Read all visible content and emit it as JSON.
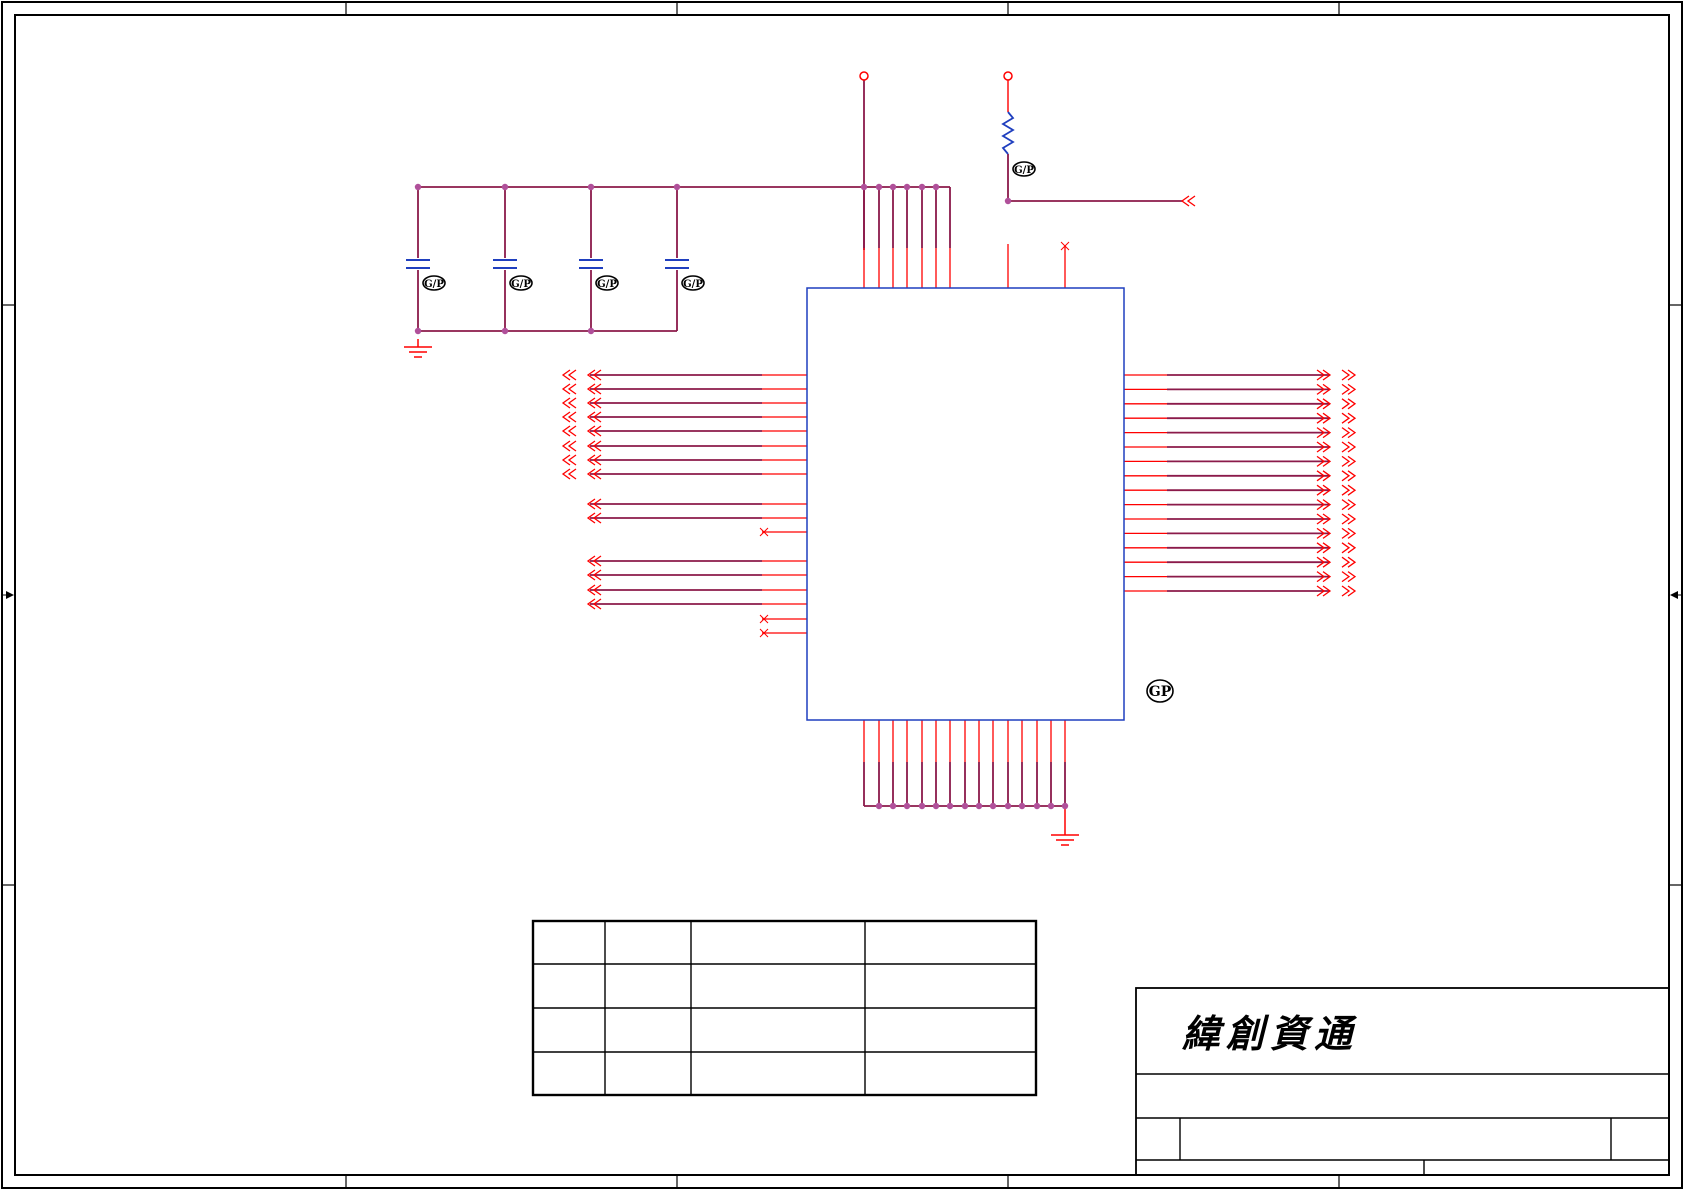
{
  "title_block": {
    "company_logo": "緯創資通"
  },
  "annotations": {
    "part_marker": "GP",
    "capacitor_marker": "G/P",
    "resistor_marker": "G/P"
  },
  "colors": {
    "wire": "#8b1a4a",
    "pin": "#ff0000",
    "component": "#1f3fbf",
    "junction": "#b0509a",
    "frame": "#000000"
  }
}
